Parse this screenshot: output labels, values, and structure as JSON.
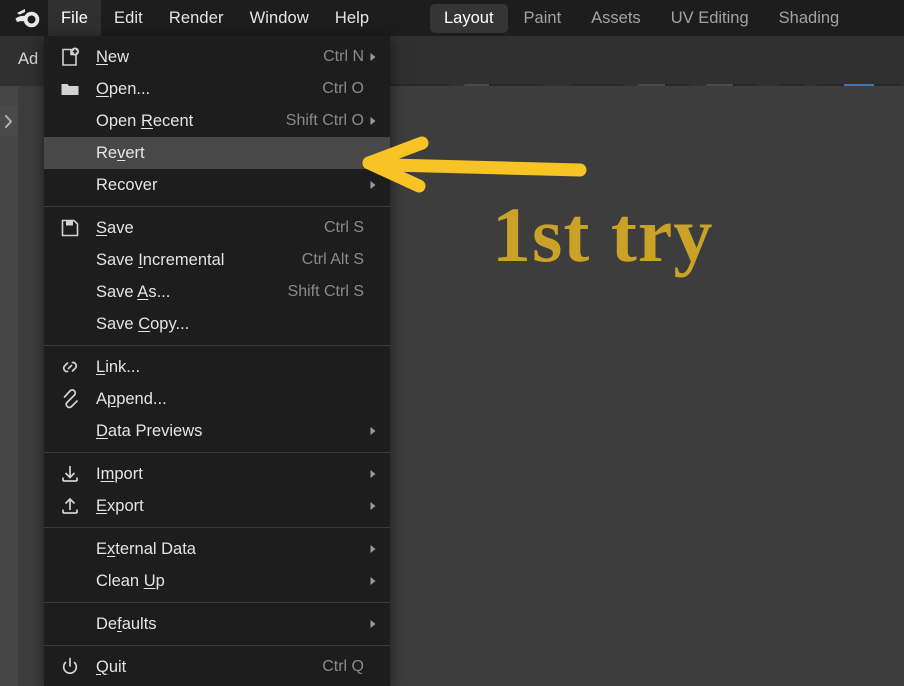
{
  "app": {
    "name": "Blender",
    "logo_icon": "blender-logo-icon"
  },
  "topbar": {
    "menus": [
      {
        "label": "File",
        "active": true
      },
      {
        "label": "Edit",
        "active": false
      },
      {
        "label": "Render",
        "active": false
      },
      {
        "label": "Window",
        "active": false
      },
      {
        "label": "Help",
        "active": false
      }
    ],
    "workspace_tabs": [
      {
        "label": "Layout",
        "active": true
      },
      {
        "label": "Paint",
        "active": false
      },
      {
        "label": "Assets",
        "active": false
      },
      {
        "label": "UV Editing",
        "active": false
      },
      {
        "label": "Shading",
        "active": false
      }
    ]
  },
  "subheader": {
    "add_label": "Ad",
    "tools": [
      {
        "icon": "snap-magnet-icon",
        "state": "off"
      },
      {
        "icon": "snap-target-grid-icon",
        "state": "off"
      },
      {
        "icon": "chevron-down-icon",
        "state": "dropdown"
      },
      {
        "icon": "proportional-editing-icon",
        "state": "on"
      },
      {
        "icon": "falloff-smooth-icon",
        "state": "off"
      },
      {
        "icon": "chevron-down-icon",
        "state": "dropdown"
      },
      {
        "icon": "show-gizmo-icon",
        "state": "off"
      },
      {
        "icon": "chevron-down-icon",
        "state": "dropdown"
      },
      {
        "icon": "show-overlays-icon",
        "state": "off"
      },
      {
        "icon": "chevron-down-icon",
        "state": "dropdown"
      },
      {
        "icon": "xray-toggle-icon",
        "state": "on"
      },
      {
        "icon": "chevron-down-icon",
        "state": "dropdown"
      },
      {
        "icon": "render-region-icon",
        "state": "off"
      },
      {
        "icon": "shading-wireframe-icon",
        "state": "off"
      },
      {
        "icon": "shading-solid-icon",
        "state": "selected"
      },
      {
        "icon": "shading-material-icon",
        "state": "off"
      }
    ]
  },
  "viewport": {
    "sidebar_toggle_icon": "chevron-right-icon"
  },
  "file_menu": {
    "sections": [
      {
        "items": [
          {
            "icon": "new-file-icon",
            "label_pre": "",
            "label_key": "N",
            "label_post": "ew",
            "shortcut": "Ctrl N",
            "submenu": true
          },
          {
            "icon": "open-folder-icon",
            "label_pre": "",
            "label_key": "O",
            "label_post": "pen...",
            "shortcut": "Ctrl O",
            "submenu": false
          },
          {
            "icon": "",
            "label_pre": "Open ",
            "label_key": "R",
            "label_post": "ecent",
            "shortcut": "Shift Ctrl O",
            "submenu": true
          },
          {
            "icon": "",
            "label_pre": "Re",
            "label_key": "v",
            "label_post": "ert",
            "shortcut": "",
            "submenu": false,
            "highlight": true
          },
          {
            "icon": "",
            "label_pre": "Recover",
            "label_key": "",
            "label_post": "",
            "shortcut": "",
            "submenu": true
          }
        ]
      },
      {
        "items": [
          {
            "icon": "save-disk-icon",
            "label_pre": "",
            "label_key": "S",
            "label_post": "ave",
            "shortcut": "Ctrl S",
            "submenu": false
          },
          {
            "icon": "",
            "label_pre": "Save ",
            "label_key": "I",
            "label_post": "ncremental",
            "shortcut": "Ctrl Alt S",
            "submenu": false
          },
          {
            "icon": "",
            "label_pre": "Save ",
            "label_key": "A",
            "label_post": "s...",
            "shortcut": "Shift Ctrl S",
            "submenu": false
          },
          {
            "icon": "",
            "label_pre": "Save ",
            "label_key": "C",
            "label_post": "opy...",
            "shortcut": "",
            "submenu": false
          }
        ]
      },
      {
        "items": [
          {
            "icon": "link-chain-icon",
            "label_pre": "",
            "label_key": "L",
            "label_post": "ink...",
            "shortcut": "",
            "submenu": false
          },
          {
            "icon": "append-clip-icon",
            "label_pre": "A",
            "label_key": "p",
            "label_post": "pend...",
            "shortcut": "",
            "submenu": false
          },
          {
            "icon": "",
            "label_pre": "",
            "label_key": "D",
            "label_post": "ata Previews",
            "shortcut": "",
            "submenu": true
          }
        ]
      },
      {
        "items": [
          {
            "icon": "import-arrow-icon",
            "label_pre": "I",
            "label_key": "m",
            "label_post": "port",
            "shortcut": "",
            "submenu": true
          },
          {
            "icon": "export-arrow-icon",
            "label_pre": "",
            "label_key": "E",
            "label_post": "xport",
            "shortcut": "",
            "submenu": true
          }
        ]
      },
      {
        "items": [
          {
            "icon": "",
            "label_pre": "E",
            "label_key": "x",
            "label_post": "ternal Data",
            "shortcut": "",
            "submenu": true
          },
          {
            "icon": "",
            "label_pre": "Clean ",
            "label_key": "U",
            "label_post": "p",
            "shortcut": "",
            "submenu": true
          }
        ]
      },
      {
        "items": [
          {
            "icon": "",
            "label_pre": "De",
            "label_key": "f",
            "label_post": "aults",
            "shortcut": "",
            "submenu": true
          }
        ]
      },
      {
        "items": [
          {
            "icon": "power-quit-icon",
            "label_pre": "",
            "label_key": "Q",
            "label_post": "uit",
            "shortcut": "Ctrl Q",
            "submenu": false
          }
        ]
      }
    ]
  },
  "annotation": {
    "text": "1st try",
    "text_color": "#C9A227",
    "arrow_color": "#F7C325",
    "arrow_icon": "left-arrow-annotation-icon",
    "points_at": "Revert"
  },
  "colors": {
    "window_bg": "#1d1d1d",
    "viewport_bg": "#3d3d3d",
    "header_bg": "#303030",
    "menu_bg": "#1d1d1d",
    "menu_highlight": "#484848",
    "accent_blue": "#4772b3",
    "text": "#e4e4e4",
    "text_dim": "#8a8a8a"
  }
}
